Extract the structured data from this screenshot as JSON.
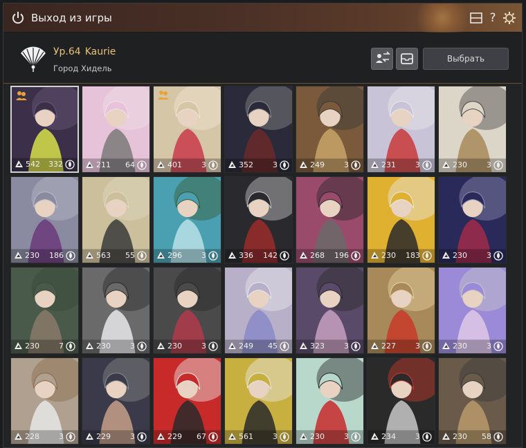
{
  "window": {
    "title": "Выход из игры"
  },
  "header": {
    "level": "Ур.64",
    "character_name": "Kaurie",
    "location": "Город Хидель",
    "select_label": "Выбрать"
  },
  "colors": {
    "accent": "#e8c27a",
    "titlebar": "#4a3026"
  },
  "characters": [
    {
      "v1": "542",
      "v2": "332",
      "group": true,
      "selected": true,
      "palette": [
        "#3b2f4a",
        "#d8e04a",
        "#6a5a7a"
      ]
    },
    {
      "v1": "211",
      "v2": "64",
      "group": false,
      "palette": [
        "#e6c3d8",
        "#7a7a7a",
        "#f0e0e8"
      ]
    },
    {
      "v1": "401",
      "v2": "3",
      "group": true,
      "palette": [
        "#d6c6a8",
        "#c83a4a",
        "#efe4d0"
      ]
    },
    {
      "v1": "352",
      "v2": "3",
      "group": false,
      "palette": [
        "#2a2a3a",
        "#6a2a2a",
        "#8a8a8a"
      ]
    },
    {
      "v1": "249",
      "v2": "3",
      "group": false,
      "palette": [
        "#7a5a3a",
        "#c9a46a",
        "#3a3a3a"
      ]
    },
    {
      "v1": "231",
      "v2": "3",
      "group": false,
      "palette": [
        "#c9c3d8",
        "#c83a3a",
        "#e8e8ea"
      ]
    },
    {
      "v1": "230",
      "v2": "3",
      "group": false,
      "palette": [
        "#dcd6c8",
        "#a88a5a",
        "#4a4a4a"
      ]
    },
    {
      "v1": "230",
      "v2": "186",
      "group": false,
      "palette": [
        "#8a8aa0",
        "#6a3a7a",
        "#b8b8c8"
      ]
    },
    {
      "v1": "563",
      "v2": "55",
      "group": false,
      "palette": [
        "#cbbf9c",
        "#3a3a3a",
        "#e0d8c0"
      ]
    },
    {
      "v1": "296",
      "v2": "3",
      "group": false,
      "palette": [
        "#4aa0b0",
        "#b8e0e8",
        "#3a5a3a"
      ]
    },
    {
      "v1": "336",
      "v2": "142",
      "group": false,
      "palette": [
        "#2a2a2e",
        "#9a2a2a",
        "#c8c8c8"
      ]
    },
    {
      "v1": "268",
      "v2": "196",
      "group": false,
      "palette": [
        "#9a4a6a",
        "#6a6a6a",
        "#2a2a2a"
      ]
    },
    {
      "v1": "230",
      "v2": "183",
      "group": false,
      "palette": [
        "#e0b030",
        "#2a2a2a",
        "#e8e8e8"
      ]
    },
    {
      "v1": "230",
      "v2": "3",
      "group": false,
      "palette": [
        "#2a2a5a",
        "#a02a4a",
        "#8a8ab0"
      ]
    },
    {
      "v1": "230",
      "v2": "7",
      "group": false,
      "palette": [
        "#4a5a4a",
        "#8a7a6a",
        "#3a4a3a"
      ]
    },
    {
      "v1": "230",
      "v2": "3",
      "group": false,
      "palette": [
        "#6a6a6a",
        "#e8e8ea",
        "#2a2a2a"
      ]
    },
    {
      "v1": "230",
      "v2": "3",
      "group": false,
      "palette": [
        "#4a4a4a",
        "#b03a4a",
        "#2a2a2a"
      ]
    },
    {
      "v1": "249",
      "v2": "45",
      "group": false,
      "palette": [
        "#b8b0c8",
        "#8a8ac8",
        "#e8e8ea"
      ]
    },
    {
      "v1": "323",
      "v2": "3",
      "group": false,
      "palette": [
        "#5a4a6a",
        "#c8a0c0",
        "#2a2a2a"
      ]
    },
    {
      "v1": "227",
      "v2": "3",
      "group": false,
      "palette": [
        "#a88a5a",
        "#c83a2a",
        "#e8d0a0"
      ]
    },
    {
      "v1": "230",
      "v2": "3",
      "group": false,
      "palette": [
        "#9a8ad8",
        "#e0c8e8",
        "#c8c8c8"
      ]
    },
    {
      "v1": "228",
      "v2": "3",
      "group": false,
      "palette": [
        "#b0a090",
        "#e8e8e8",
        "#8a6a4a"
      ]
    },
    {
      "v1": "229",
      "v2": "3",
      "group": false,
      "palette": [
        "#3a3a4a",
        "#c8a08a",
        "#8a8a8a"
      ]
    },
    {
      "v1": "229",
      "v2": "67",
      "group": false,
      "palette": [
        "#c82a2a",
        "#2a2a2a",
        "#e8e8e8"
      ]
    },
    {
      "v1": "561",
      "v2": "3",
      "group": false,
      "palette": [
        "#c8b040",
        "#2a2a2a",
        "#e8e8e8"
      ]
    },
    {
      "v1": "230",
      "v2": "3",
      "group": false,
      "palette": [
        "#b8d8cc",
        "#c82a2a",
        "#2a2a2a"
      ]
    },
    {
      "v1": "234",
      "v2": "3",
      "group": false,
      "palette": [
        "#2a2a2a",
        "#c8c8c8",
        "#c83a2a"
      ]
    },
    {
      "v1": "230",
      "v2": "58",
      "group": false,
      "palette": [
        "#6a5a4a",
        "#b89a6a",
        "#3a3a3a"
      ]
    }
  ]
}
